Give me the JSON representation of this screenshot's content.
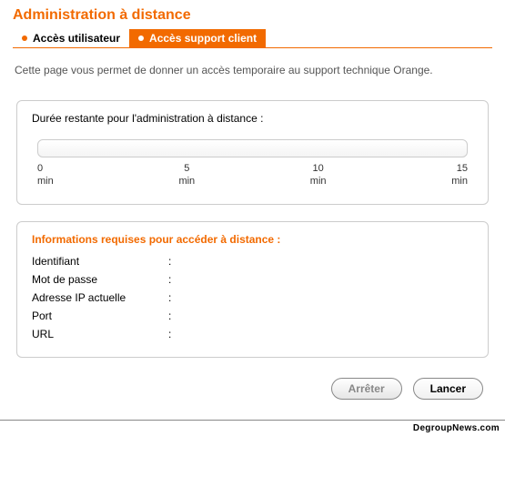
{
  "header": {
    "title": "Administration à distance"
  },
  "tabs": [
    {
      "label": "Accès utilisateur",
      "active": false
    },
    {
      "label": "Accès support client",
      "active": true
    }
  ],
  "description": "Cette page vous permet de donner un accès temporaire au support technique Orange.",
  "duration": {
    "title": "Durée restante pour l'administration à distance :",
    "ticks": [
      {
        "value": "0",
        "unit": "min"
      },
      {
        "value": "5",
        "unit": "min"
      },
      {
        "value": "10",
        "unit": "min"
      },
      {
        "value": "15",
        "unit": "min"
      }
    ]
  },
  "info": {
    "title": "Informations requises pour accéder à distance :",
    "rows": [
      {
        "label": "Identifiant",
        "value": ""
      },
      {
        "label": "Mot de passe",
        "value": ""
      },
      {
        "label": "Adresse IP actuelle",
        "value": ""
      },
      {
        "label": "Port",
        "value": ""
      },
      {
        "label": "URL",
        "value": ""
      }
    ]
  },
  "actions": {
    "stop": "Arrêter",
    "start": "Lancer"
  },
  "footer": "DegroupNews.com"
}
